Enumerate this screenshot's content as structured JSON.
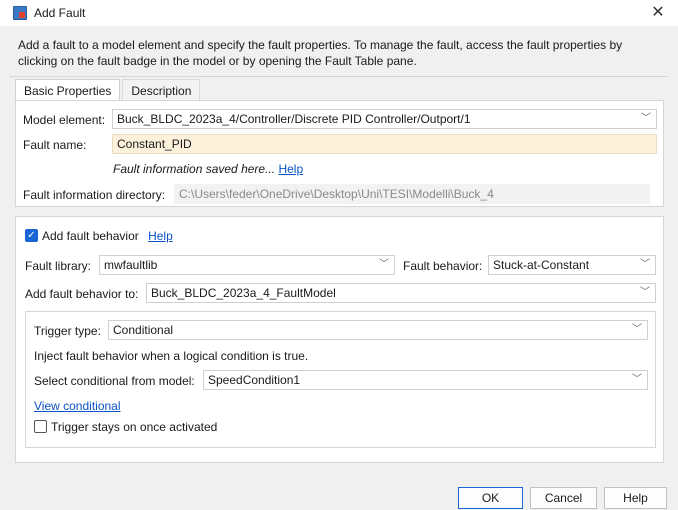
{
  "window": {
    "title": "Add Fault",
    "close_glyph": "✕"
  },
  "description": "Add a fault to a model element and specify the fault properties. To manage the fault, access the fault properties by clicking on the fault badge in the model or by opening the Fault Table pane.",
  "tabs": [
    {
      "label": "Basic Properties",
      "active": true
    },
    {
      "label": "Description",
      "active": false
    }
  ],
  "basic": {
    "model_element_label": "Model element:",
    "model_element_value": "Buck_BLDC_2023a_4/Controller/Discrete PID Controller/Outport/1",
    "fault_name_label": "Fault name:",
    "fault_name_value": "Constant_PID",
    "info_saved_text": "Fault information saved here...",
    "help_link": "Help",
    "info_dir_label": "Fault information directory:",
    "info_dir_value": "C:\\Users\\feder\\OneDrive\\Desktop\\Uni\\TESI\\Modelli\\Buck_4"
  },
  "behavior": {
    "add_behavior_checked": true,
    "add_behavior_label": "Add fault behavior",
    "help_link": "Help",
    "library_label": "Fault library:",
    "library_value": "mwfaultlib",
    "fault_behavior_label": "Fault behavior:",
    "fault_behavior_value": "Stuck-at-Constant",
    "add_to_label": "Add fault behavior to:",
    "add_to_value": "Buck_BLDC_2023a_4_FaultModel"
  },
  "trigger": {
    "type_label": "Trigger type:",
    "type_value": "Conditional",
    "inject_text": "Inject fault behavior when a logical condition is true.",
    "select_label": "Select conditional from model:",
    "select_value": "SpeedCondition1",
    "view_link": "View conditional",
    "stays_on_checked": false,
    "stays_on_label": "Trigger stays on once activated"
  },
  "buttons": {
    "ok": "OK",
    "cancel": "Cancel",
    "help": "Help"
  },
  "colors": {
    "accent": "#1a66d6",
    "link": "#0a52c8",
    "field_highlight": "#fdf1dc"
  }
}
